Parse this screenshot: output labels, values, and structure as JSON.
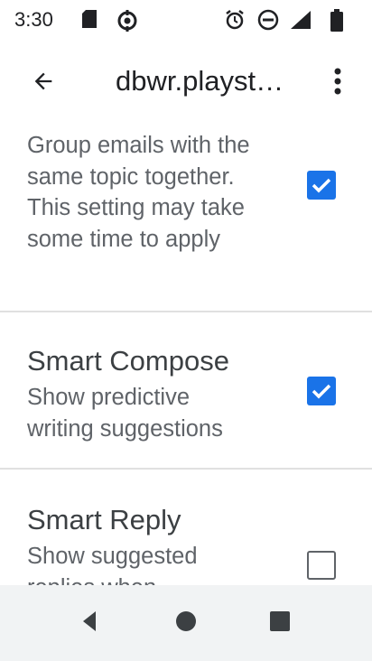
{
  "status_bar": {
    "time": "3:30",
    "icons_left": [
      "sd-card-icon",
      "sync-icon"
    ],
    "icons_right": [
      "alarm-icon",
      "do-not-disturb-icon",
      "signal-icon",
      "battery-icon"
    ]
  },
  "app_bar": {
    "title": "dbwr.playstoreapp@gmail.com",
    "back_icon": "arrow-back-icon",
    "menu_icon": "more-vert-icon"
  },
  "settings": [
    {
      "title": "",
      "description": "Group emails with the same topic together. This setting may take some time to apply",
      "checked": true
    },
    {
      "title": "Smart Compose",
      "description": "Show predictive writing suggestions",
      "checked": true
    },
    {
      "title": "Smart Reply",
      "description": "Show suggested replies when available",
      "checked": false
    }
  ],
  "nav_bar": {
    "back": "nav-back-icon",
    "home": "nav-home-icon",
    "recents": "nav-recents-icon"
  },
  "colors": {
    "accent": "#1a73e8",
    "nav_background": "#f1f3f4"
  }
}
